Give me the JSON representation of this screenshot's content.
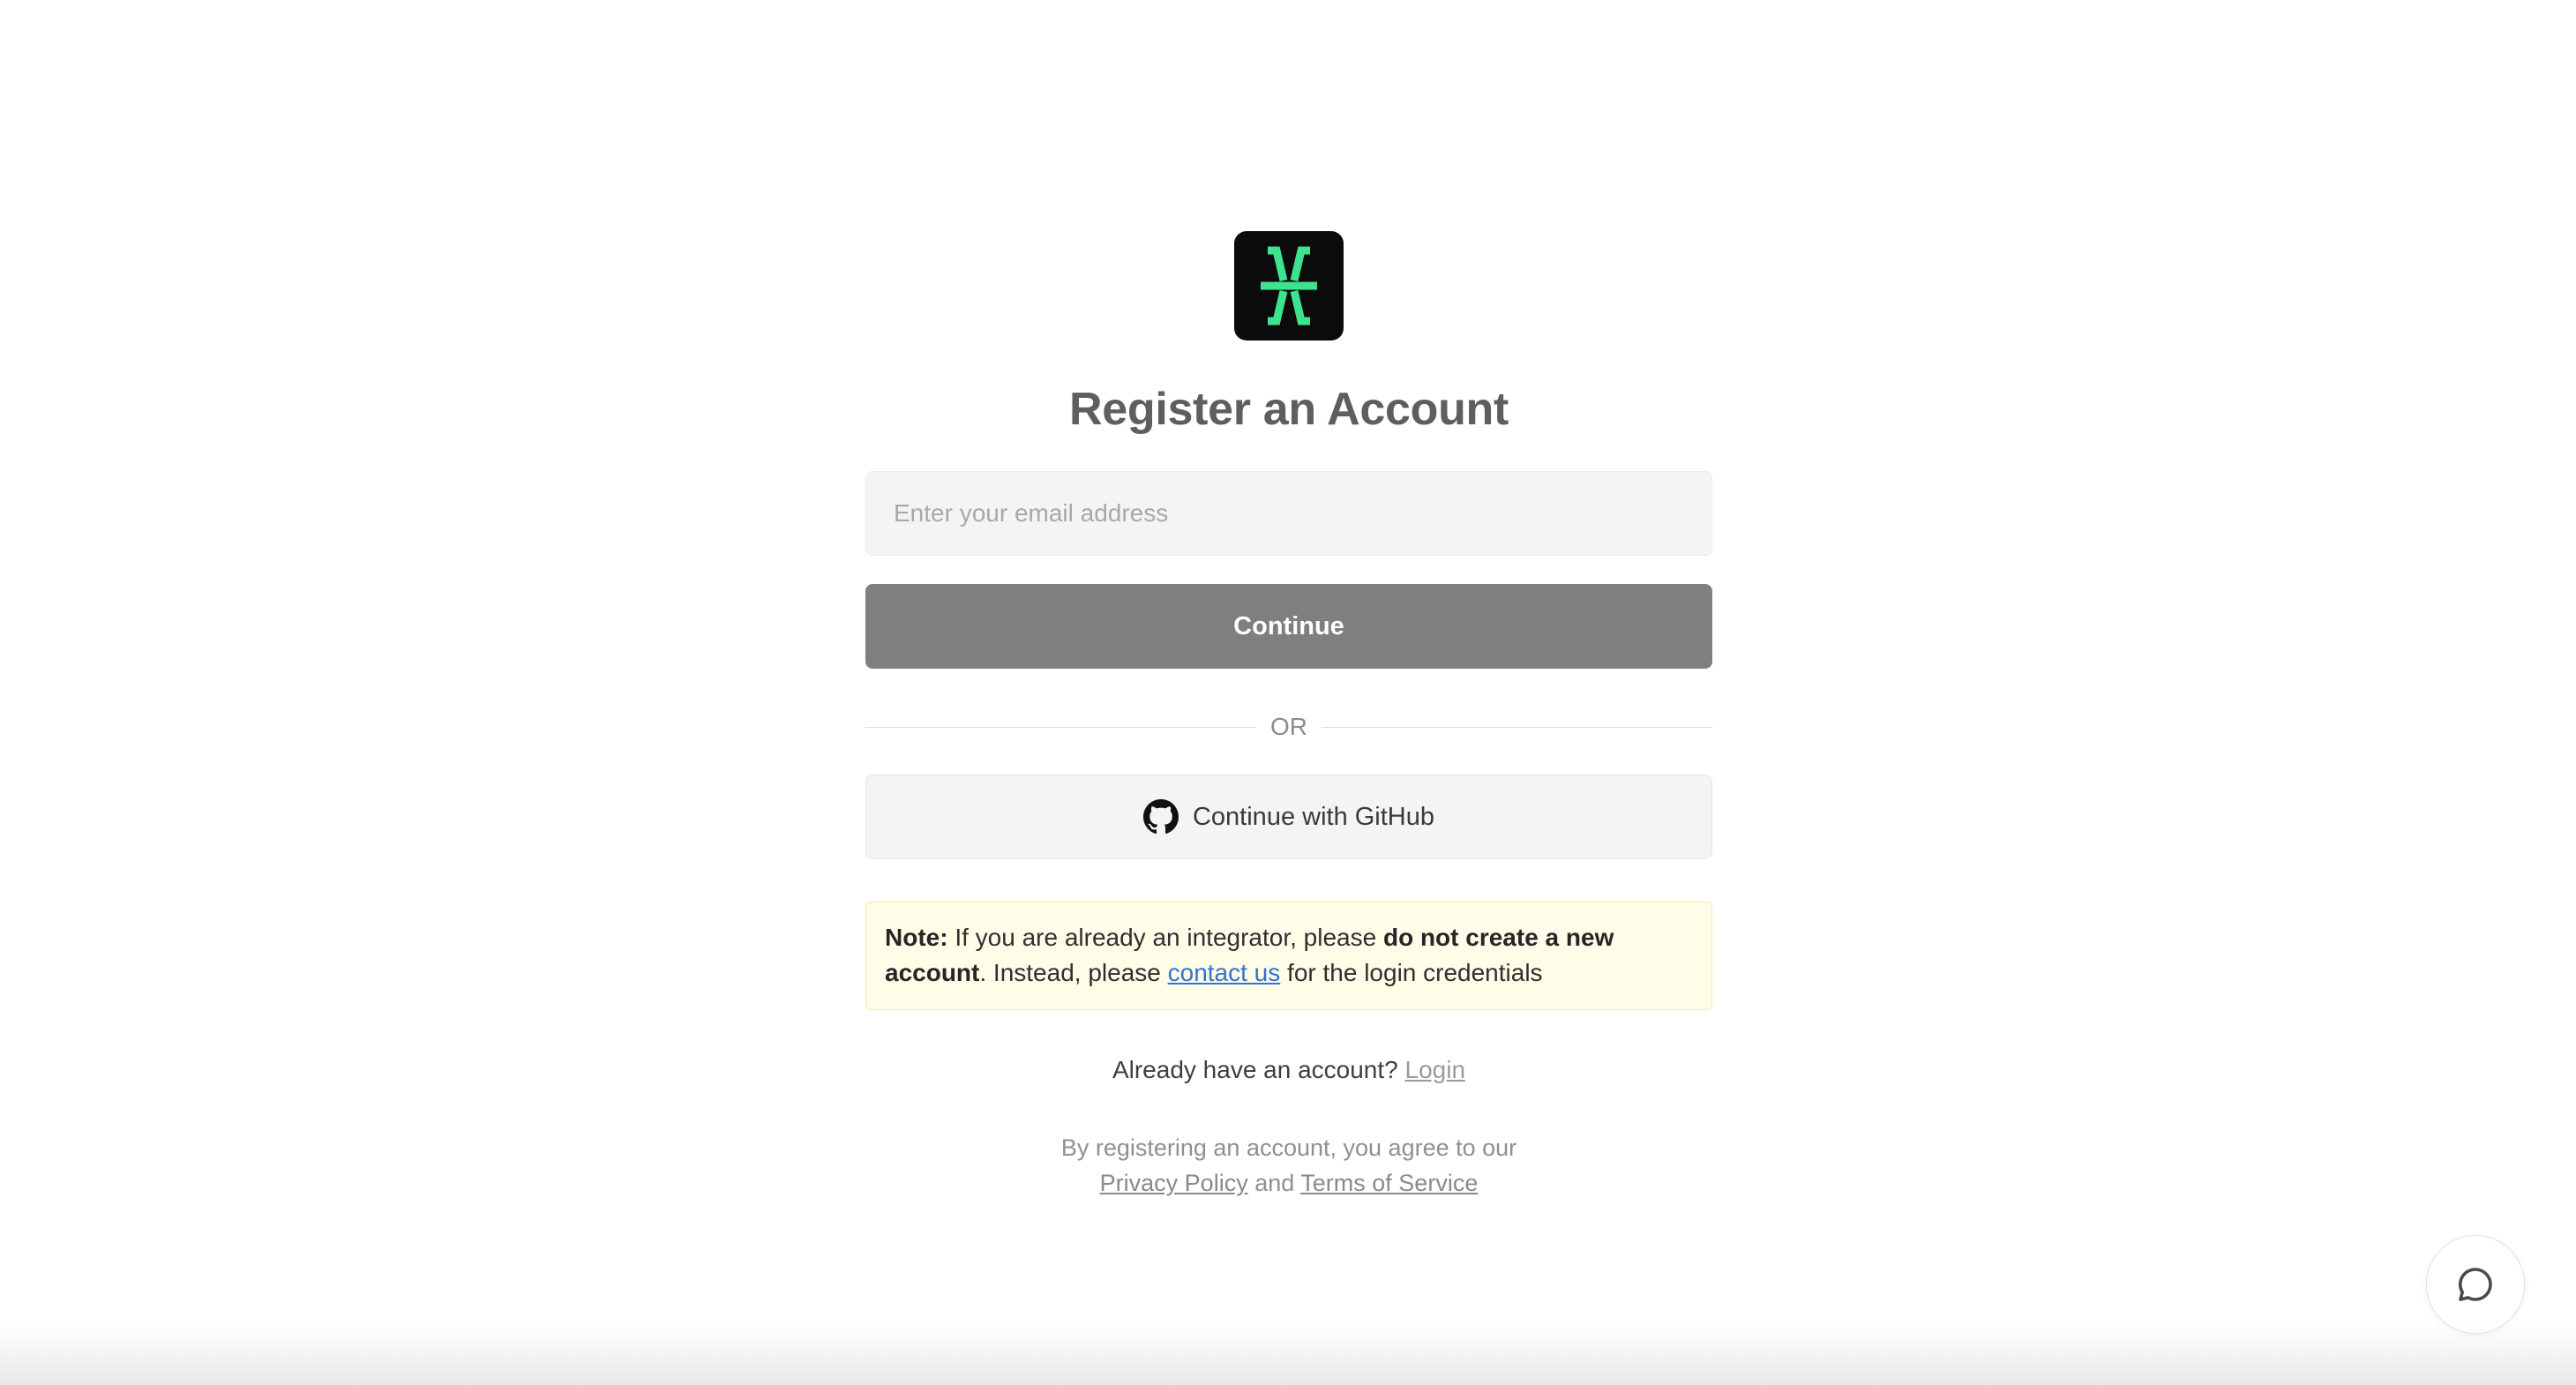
{
  "brand": {
    "logo_icon": "x-logo-icon",
    "logo_background": "#0b0b0b",
    "logo_accent": "#3ee38f"
  },
  "form": {
    "title": "Register an Account",
    "email_placeholder": "Enter your email address",
    "email_value": "",
    "continue_label": "Continue",
    "divider_text": "OR",
    "github_label": "Continue with GitHub",
    "github_icon": "github-icon"
  },
  "note": {
    "label": "Note:",
    "text_1": " If you are already an integrator, please ",
    "bold_text": "do not create a new account",
    "text_2": ". Instead, please ",
    "link_text": "contact us",
    "text_3": " for the login credentials"
  },
  "login": {
    "prompt": "Already have an account? ",
    "link_text": "Login"
  },
  "legal": {
    "line_1": "By registering an account, you agree to our",
    "privacy_link": "Privacy Policy",
    "and_text": " and ",
    "terms_link": "Terms of Service"
  },
  "chat": {
    "icon": "chat-bubble-icon"
  },
  "colors": {
    "continue_button": "#7f7f7f",
    "note_background": "#fffce8",
    "note_border": "#f7eca3",
    "link_blue": "#2f74d0"
  }
}
